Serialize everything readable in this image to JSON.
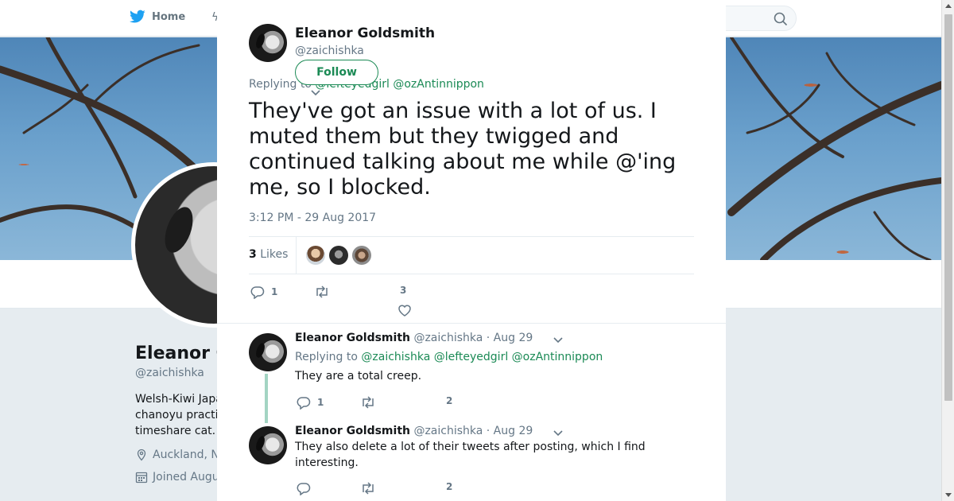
{
  "background": {
    "nav": {
      "home_label": "Home"
    },
    "profile": {
      "name": "Eleanor G",
      "handle": "@zaichishka",
      "bio": [
        "Welsh-Kiwi Japa",
        "chanoyu practi",
        "timeshare cat."
      ],
      "location": "Auckland, N",
      "joined": "Joined Augu"
    }
  },
  "tweet": {
    "name": "Eleanor Goldsmith",
    "handle": "@zaichishka",
    "follow_label": "Follow",
    "replying_prefix": "Replying to",
    "replying_mentions": "@lefteyedgirl @ozAntinnippon",
    "text": "They've got an issue with a lot of us. I muted them but they twigged and continued talking about me while @'ing me, so I blocked.",
    "timestamp": "3:12 PM - 29 Aug 2017",
    "likes_count": "3",
    "likes_label": "Likes",
    "actions": {
      "replies": "1",
      "retweets": "",
      "likes": "3"
    }
  },
  "replies": [
    {
      "name": "Eleanor Goldsmith",
      "handle": "@zaichishka",
      "date": "· Aug 29",
      "replying_prefix": "Replying to",
      "replying_mentions": "@zaichishka @lefteyedgirl @ozAntinnippon",
      "text": "They are a total creep.",
      "actions": {
        "replies": "1",
        "likes": "2"
      }
    },
    {
      "name": "Eleanor Goldsmith",
      "handle": "@zaichishka",
      "date": "· Aug 29",
      "text": "They also delete a lot of their tweets after posting, which I find interesting.",
      "actions": {
        "replies": "",
        "likes": "2"
      }
    }
  ],
  "colors": {
    "accent": "#1b8a55",
    "muted": "#657786",
    "thread_line": "#a3d4c3"
  }
}
